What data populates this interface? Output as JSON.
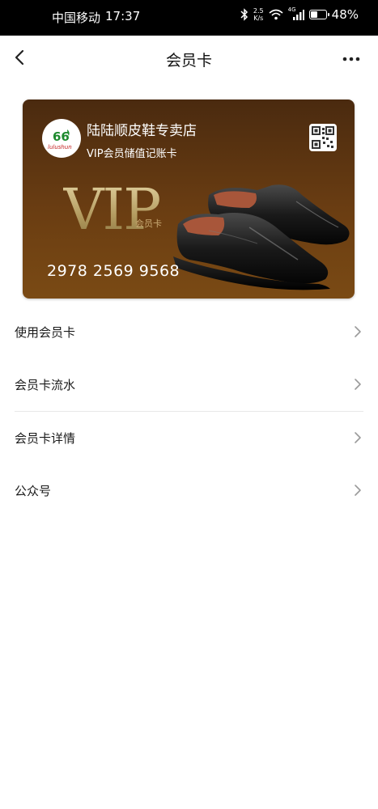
{
  "status_bar": {
    "carrier": "中国移动",
    "time": "17:37",
    "net_speed_value": "2.5",
    "net_speed_unit": "K/s",
    "signal_label": "4G",
    "battery_percent": "48%",
    "battery_level": 0.48
  },
  "nav": {
    "title": "会员卡"
  },
  "card": {
    "shop_name": "陆陆顺皮鞋专卖店",
    "card_type": "VIP会员储值记账卡",
    "vip_text": "VIP",
    "vip_sub": "会员卡",
    "card_number": "2978 2569 9568",
    "logo_number": "66",
    "logo_sub": "lulushun",
    "colors": {
      "gradient_top": "#4a2a0f",
      "gradient_bottom": "#7a4a14",
      "vip_gold": "#c9b47a"
    }
  },
  "menu": {
    "items": [
      {
        "label": "使用会员卡"
      },
      {
        "label": "会员卡流水"
      },
      {
        "label": "会员卡详情"
      },
      {
        "label": "公众号"
      }
    ]
  }
}
